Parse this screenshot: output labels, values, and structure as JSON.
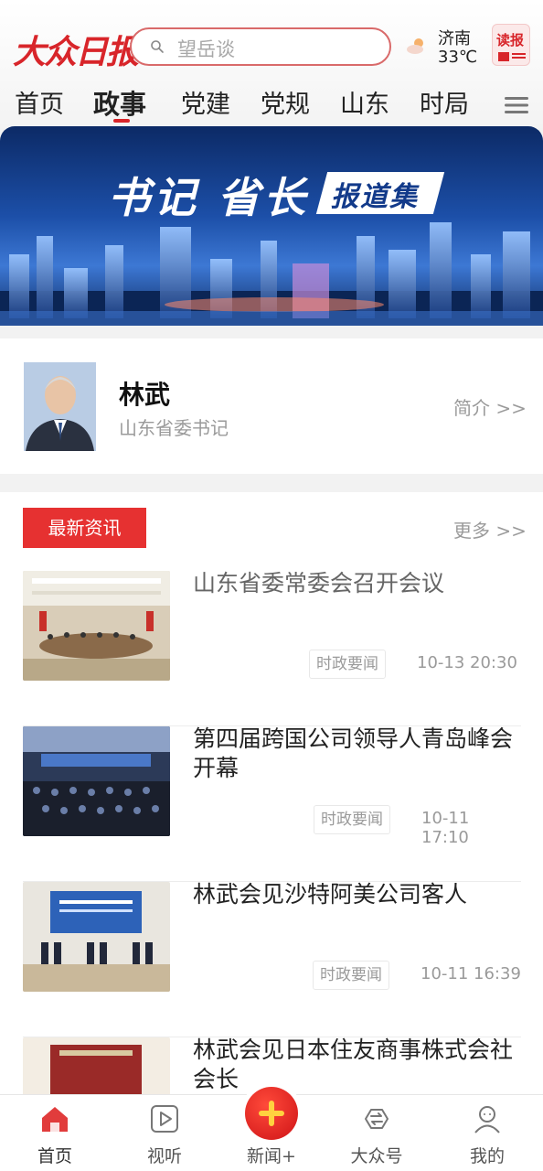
{
  "header": {
    "logo_text": "大众日报",
    "search_placeholder": "望岳谈",
    "city": "济南",
    "temperature": "33℃",
    "read_paper_label": "读报"
  },
  "tabs": [
    {
      "label": "首页",
      "active": false
    },
    {
      "label": "政事",
      "active": true
    },
    {
      "label": "党建",
      "active": false
    },
    {
      "label": "党规",
      "active": false
    },
    {
      "label": "山东",
      "active": false
    },
    {
      "label": "时局",
      "active": false
    }
  ],
  "banner": {
    "title": "书记 省长",
    "tag": "报道集"
  },
  "profile": {
    "name": "林武",
    "title": "山东省委书记",
    "intro_link": "简介 >>"
  },
  "news_section": {
    "label": "最新资讯",
    "more_link": "更多 >>",
    "items": [
      {
        "title": "山东省委常委会召开会议",
        "tag": "时政要闻",
        "time": "10-13 20:30",
        "read": true
      },
      {
        "title": "第四届跨国公司领导人青岛峰会开幕",
        "tag": "时政要闻",
        "time": "10-11 17:10",
        "read": false
      },
      {
        "title": "林武会见沙特阿美公司客人",
        "tag": "时政要闻",
        "time": "10-11 16:39",
        "read": false
      },
      {
        "title": "林武会见日本住友商事株式会社会长",
        "tag": "",
        "time": "",
        "read": false
      }
    ]
  },
  "bottom_nav": [
    {
      "label": "首页",
      "icon": "home-icon",
      "active": true
    },
    {
      "label": "视听",
      "icon": "video-icon",
      "active": false
    },
    {
      "label": "新闻+",
      "icon": "plus-icon",
      "active": false
    },
    {
      "label": "大众号",
      "icon": "exchange-icon",
      "active": false
    },
    {
      "label": "我的",
      "icon": "user-icon",
      "active": false
    }
  ],
  "colors": {
    "brand_red": "#d8252a",
    "section_red": "#e63131",
    "muted_text": "#9a9a9a"
  }
}
